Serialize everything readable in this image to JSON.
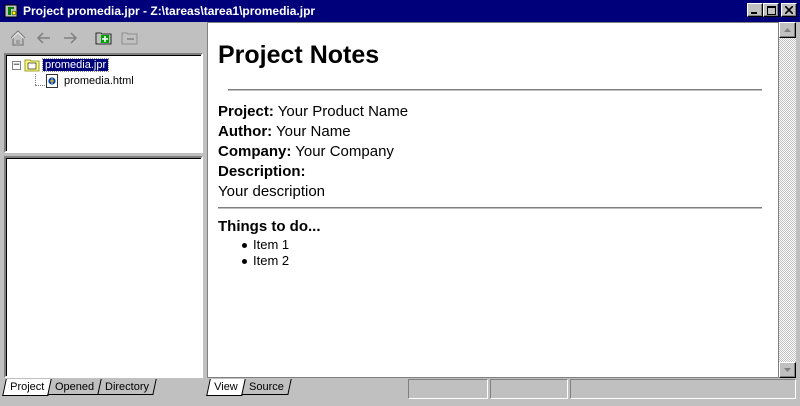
{
  "window": {
    "title": "Project promedia.jpr - Z:\\tareas\\tarea1\\promedia.jpr",
    "title_bar_color": "#00007b",
    "buttons": [
      "minimize-icon",
      "maximize-icon",
      "close-icon"
    ]
  },
  "left_toolbar": {
    "icons": [
      "home-icon",
      "back-arrow-icon",
      "forward-arrow-icon",
      "add-to-project-icon",
      "remove-from-project-icon"
    ]
  },
  "project_tree": {
    "items": [
      {
        "label": "promedia.jpr",
        "icon": "project-folder-icon",
        "selected": true,
        "expanded": true
      },
      {
        "label": "promedia.html",
        "icon": "html-file-icon",
        "selected": false
      }
    ]
  },
  "left_tabs": [
    {
      "label": "Project",
      "active": true
    },
    {
      "label": "Opened",
      "active": false
    },
    {
      "label": "Directory",
      "active": false
    }
  ],
  "document": {
    "heading": "Project Notes",
    "fields": [
      {
        "label": "Project:",
        "value": " Your Product Name"
      },
      {
        "label": "Author:",
        "value": " Your Name"
      },
      {
        "label": "Company:",
        "value": " Your Company"
      },
      {
        "label": "Description:",
        "value": ""
      }
    ],
    "description_text": "Your description",
    "todo_title": "Things to do...",
    "todo_items": [
      "Item 1",
      "Item 2"
    ]
  },
  "right_tabs": [
    {
      "label": "View",
      "active": true
    },
    {
      "label": "Source",
      "active": false
    }
  ]
}
